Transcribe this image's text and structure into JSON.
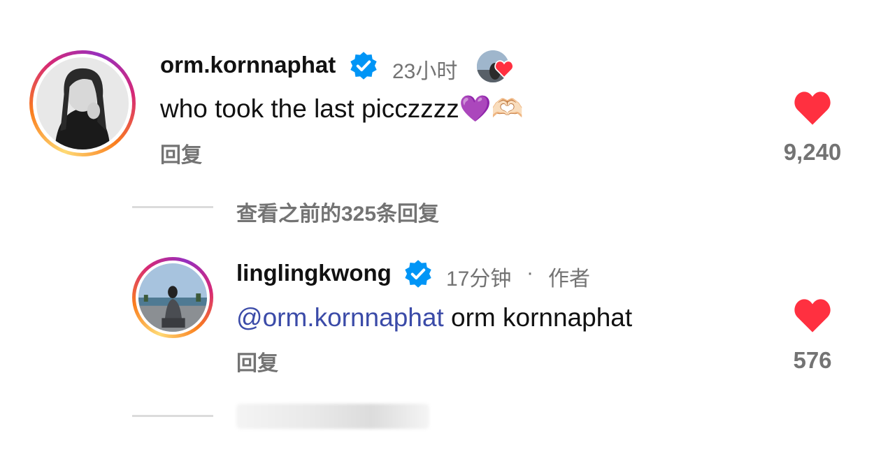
{
  "comments": [
    {
      "username": "orm.kornnaphat",
      "time": "23小时",
      "text": "who took the last picczzzz💜🫶🏻",
      "reply_label": "回复",
      "likes": "9,240"
    },
    {
      "username": "linglingkwong",
      "time": "17分钟",
      "separator": "·",
      "author_tag": "作者",
      "mention": "orm.kornnaphat",
      "text": " orm kornnaphat",
      "reply_label": "回复",
      "likes": "576"
    }
  ],
  "thread": {
    "view_previous": "查看之前的325条回复"
  },
  "colors": {
    "verified": "#0095f6",
    "heart": "#ff3040",
    "mention": "#3b4ba8",
    "muted": "#737373"
  }
}
